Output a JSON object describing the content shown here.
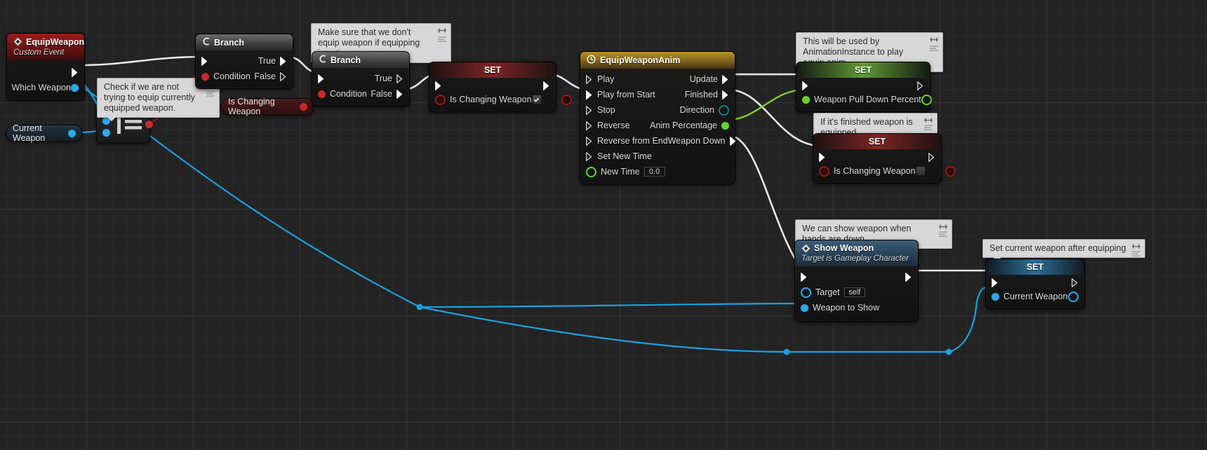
{
  "graph": {
    "app": "Unreal Engine Blueprint Event Graph",
    "background_color": "#232323"
  },
  "nodes": {
    "equip_weapon_event": {
      "title": "EquipWeapon",
      "subtitle": "Custom Event",
      "output_pin": "Which Weapon"
    },
    "branch_1": {
      "title": "Branch",
      "condition": "Condition",
      "true": "True",
      "false": "False"
    },
    "branch_2": {
      "title": "Branch",
      "condition": "Condition",
      "true": "True",
      "false": "False"
    },
    "set_is_changing_weapon_true": {
      "title": "SET",
      "property": "Is Changing Weapon",
      "value_checked": true
    },
    "equip_weapon_anim": {
      "title": "EquipWeaponAnim",
      "inputs": [
        "Play",
        "Play from Start",
        "Stop",
        "Reverse",
        "Reverse from End",
        "Set New Time"
      ],
      "new_time_label": "New Time",
      "new_time_value": "0.0",
      "outputs": [
        "Update",
        "Finished",
        "Direction",
        "Anim Percentage",
        "Weapon Down"
      ]
    },
    "set_weapon_pull_down": {
      "title": "SET",
      "property": "Weapon Pull Down Percent"
    },
    "set_is_changing_weapon_false": {
      "title": "SET",
      "property": "Is Changing Weapon",
      "value_checked": false
    },
    "show_weapon": {
      "title": "Show Weapon",
      "subtitle": "Target is Gameplay Character",
      "target_label": "Target",
      "target_value": "self",
      "weapon_to_show_label": "Weapon to Show"
    },
    "set_current_weapon": {
      "title": "SET",
      "property": "Current Weapon"
    },
    "var_is_changing_weapon": {
      "label": "Is Changing Weapon"
    },
    "var_current_weapon": {
      "label": "Current Weapon"
    }
  },
  "comments": {
    "check_equip": "Check if we are not trying to equip currently equipped weapon.",
    "make_sure": "Make sure that we don't equip weapon if equipping is active.",
    "animation_instance": "This will be used by AnimationInstance to play equip anim.",
    "finished_equipped": "If it's finished weapon is equipped",
    "show_when_down": "We can show weapon when hands are down",
    "set_after_equip": "Set current weapon after equipping"
  },
  "colors": {
    "exec_wire": "#e8e8e8",
    "object_wire": "#1ba1e2",
    "float_wire": "#7fd42a",
    "bool_pin": "#c22b2b",
    "object_pin": "#2ea8e6",
    "float_pin": "#63d12e",
    "event_header": "#9c1b1b",
    "function_header": "#3c5d79",
    "timeline_header": "#b99326"
  }
}
